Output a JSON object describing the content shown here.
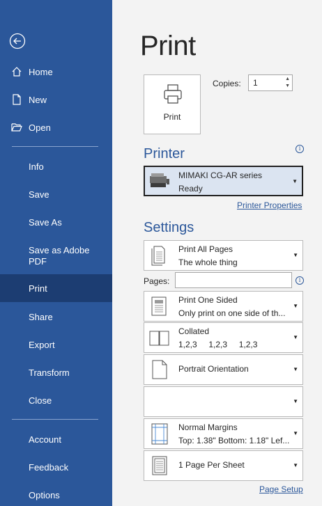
{
  "sidebar": {
    "items": [
      {
        "label": "Home",
        "icon": "home-icon"
      },
      {
        "label": "New",
        "icon": "new-document-icon"
      },
      {
        "label": "Open",
        "icon": "folder-open-icon"
      },
      {
        "label": "Info"
      },
      {
        "label": "Save"
      },
      {
        "label": "Save As"
      },
      {
        "label": "Save as Adobe PDF"
      },
      {
        "label": "Print"
      },
      {
        "label": "Share"
      },
      {
        "label": "Export"
      },
      {
        "label": "Transform"
      },
      {
        "label": "Close"
      },
      {
        "label": "Account"
      },
      {
        "label": "Feedback"
      },
      {
        "label": "Options"
      }
    ],
    "active": "Print"
  },
  "main": {
    "title": "Print",
    "print_button_label": "Print",
    "copies_label": "Copies:",
    "copies_value": "1",
    "printer": {
      "heading": "Printer",
      "name": "MIMAKI CG-AR series",
      "status": "Ready",
      "properties_link": "Printer Properties"
    },
    "settings": {
      "heading": "Settings",
      "pages_label": "Pages:",
      "pages_value": "",
      "print_range": {
        "line1": "Print All Pages",
        "line2": "The whole thing"
      },
      "sides": {
        "line1": "Print One Sided",
        "line2": "Only print on one side of th..."
      },
      "collation": {
        "line1": "Collated",
        "line2": "1,2,3     1,2,3     1,2,3"
      },
      "orientation": {
        "line1": "Portrait Orientation"
      },
      "paper": {
        "line1": ""
      },
      "margins": {
        "line1": "Normal Margins",
        "line2": "Top: 1.38\" Bottom: 1.18\" Lef..."
      },
      "pages_per_sheet": {
        "line1": "1 Page Per Sheet"
      },
      "page_setup_link": "Page Setup"
    }
  },
  "colors": {
    "accent": "#2b579a",
    "sidebar_active": "#1c3d72",
    "printer_bg": "#dbe4f1"
  }
}
